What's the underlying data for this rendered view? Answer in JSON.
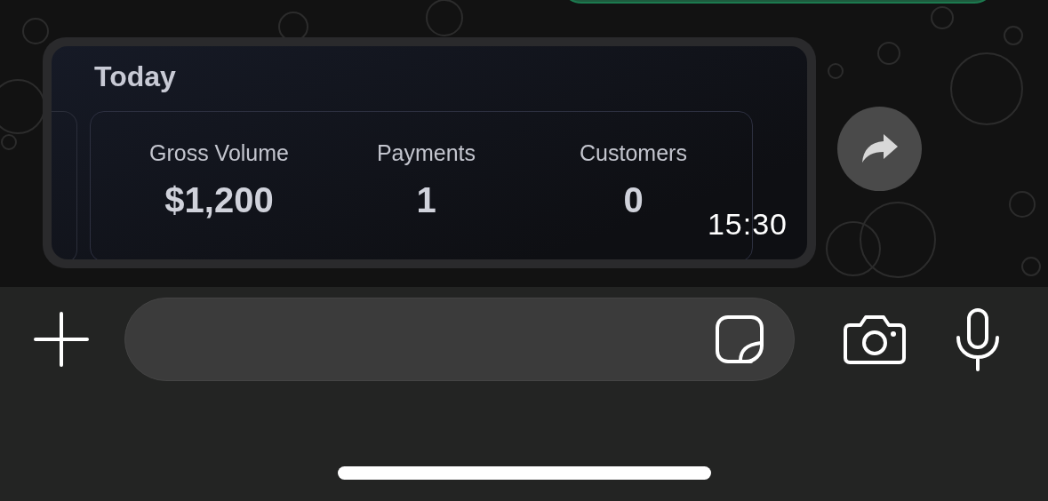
{
  "message": {
    "title": "Today",
    "stats": [
      {
        "label": "Gross Volume",
        "value": "$1,200"
      },
      {
        "label": "Payments",
        "value": "1"
      },
      {
        "label": "Customers",
        "value": "0"
      }
    ],
    "time": "15:30"
  }
}
